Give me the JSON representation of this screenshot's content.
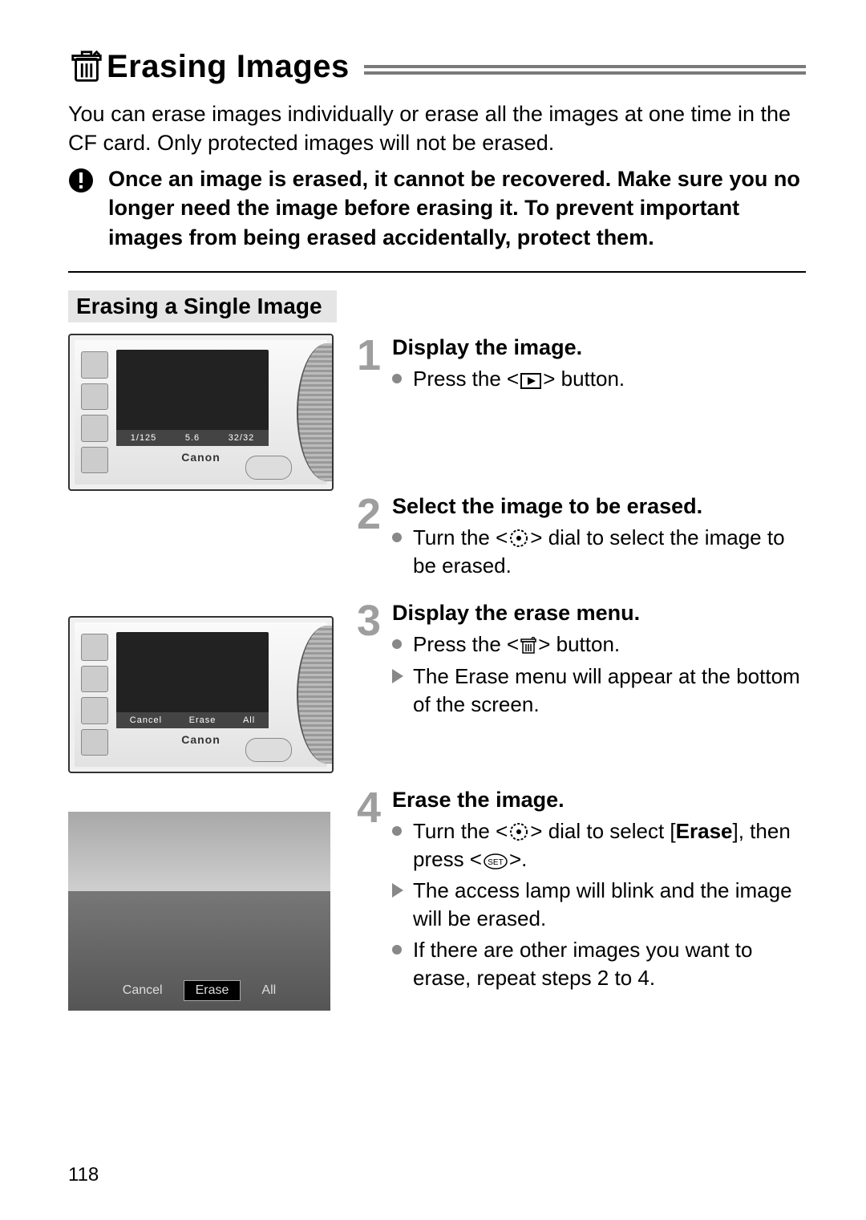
{
  "page_number": "118",
  "title": "Erasing Images",
  "intro": "You can erase images individually or erase all the images at one time in the CF card. Only protected images will not be erased.",
  "warning": "Once an image is erased, it cannot be recovered. Make sure you no longer need the image before erasing it. To prevent important images from being erased accidentally, protect them.",
  "subheading": "Erasing a Single Image",
  "illus": {
    "canon": "Canon",
    "menu_cancel": "Cancel",
    "menu_erase": "Erase",
    "menu_all": "All",
    "overlay_shutter": "1/125",
    "overlay_ap": "5.6",
    "overlay_count": "32/32"
  },
  "steps": [
    {
      "num": "1",
      "title": "Display the image.",
      "items": [
        {
          "kind": "round",
          "pre": "Press the <",
          "icon": "playback",
          "post": "> button."
        }
      ]
    },
    {
      "num": "2",
      "title": "Select the image to be erased.",
      "items": [
        {
          "kind": "round",
          "pre": "Turn the <",
          "icon": "dial",
          "post": "> dial to select the image to be erased."
        }
      ]
    },
    {
      "num": "3",
      "title": "Display the erase menu.",
      "items": [
        {
          "kind": "round",
          "pre": "Press the <",
          "icon": "trash",
          "post": "> button."
        },
        {
          "kind": "arrow",
          "text": "The Erase menu will appear at the bottom of the screen."
        }
      ]
    },
    {
      "num": "4",
      "title": "Erase the image.",
      "items": [
        {
          "kind": "round",
          "pre": "Turn the <",
          "icon": "dial",
          "mid": "> dial to select [",
          "bold": "Erase",
          "mid2": "], then press <",
          "icon2": "set",
          "post": ">."
        },
        {
          "kind": "arrow",
          "text": "The access lamp will blink and the image will be erased."
        },
        {
          "kind": "round",
          "text": "If there are other images you want to erase, repeat steps 2 to 4."
        }
      ]
    }
  ]
}
